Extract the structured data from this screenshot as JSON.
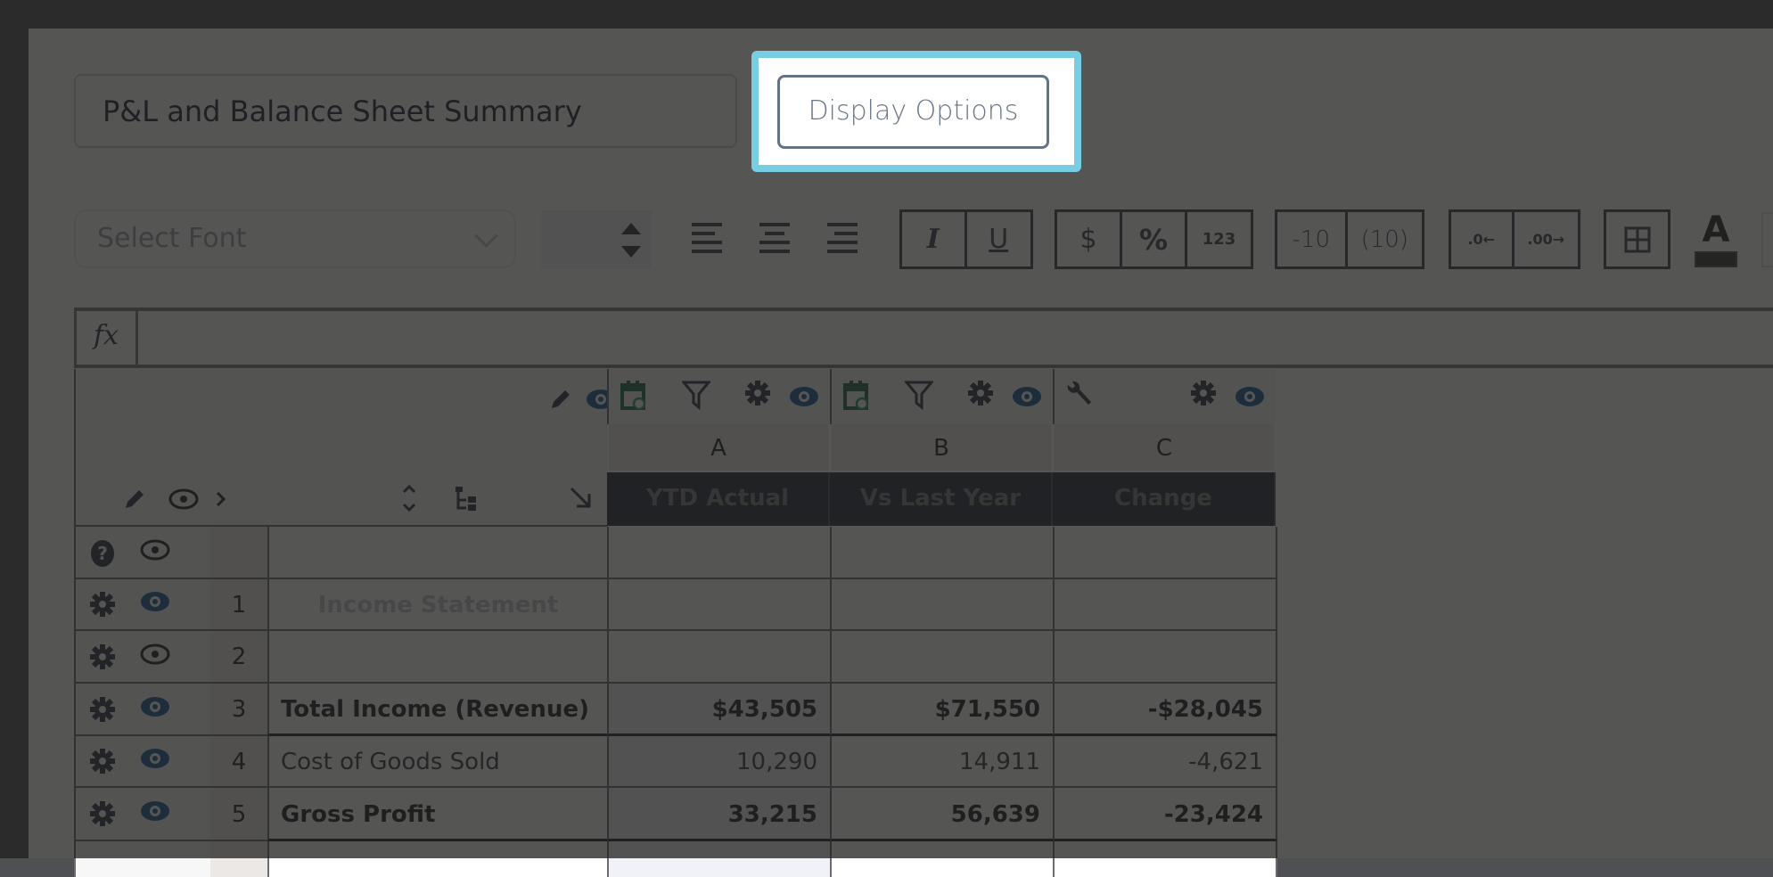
{
  "report": {
    "title": "P&L and Balance Sheet Summary",
    "display_options_label": "Display Options"
  },
  "toolbar": {
    "font_placeholder": "Select Font",
    "font_size_value": "",
    "align": [
      "align-left",
      "align-center",
      "align-right"
    ],
    "style_buttons": [
      "I",
      "U"
    ],
    "format_buttons": [
      "$",
      "%",
      "123"
    ],
    "negative_buttons": [
      "-10",
      "(10)"
    ],
    "decimal_buttons": [
      ".0←",
      ".00→"
    ],
    "border_button": "borders",
    "text_color_label": "A"
  },
  "formula_bar": {
    "icon": "fx",
    "value": ""
  },
  "grid": {
    "columns": [
      {
        "letter": "A",
        "title": "YTD Actual",
        "icons": [
          "calendar-refresh-icon",
          "filter-icon",
          "gear-icon",
          "eye-icon"
        ]
      },
      {
        "letter": "B",
        "title": "Vs Last Year",
        "icons": [
          "calendar-refresh-icon",
          "filter-icon",
          "gear-icon",
          "eye-icon"
        ]
      },
      {
        "letter": "C",
        "title": "Change",
        "icons": [
          "wrench-icon",
          "gear-icon",
          "eye-icon"
        ]
      }
    ],
    "rows": [
      {
        "num": "",
        "label": "",
        "values": [
          "",
          "",
          ""
        ],
        "style": "header-spacer",
        "visible": false
      },
      {
        "num": "1",
        "label": "Income Statement",
        "values": [
          "",
          "",
          ""
        ],
        "style": "section",
        "visible": true
      },
      {
        "num": "2",
        "label": "",
        "values": [
          "",
          "",
          ""
        ],
        "style": "blank",
        "visible": false
      },
      {
        "num": "3",
        "label": "Total Income (Revenue)",
        "values": [
          "$43,505",
          "$71,550",
          "-$28,045"
        ],
        "style": "bold",
        "visible": true
      },
      {
        "num": "4",
        "label": "Cost of Goods Sold",
        "values": [
          "10,290",
          "14,911",
          "-4,621"
        ],
        "style": "normal",
        "visible": true
      },
      {
        "num": "5",
        "label": "Gross Profit",
        "values": [
          "33,215",
          "56,639",
          "-23,424"
        ],
        "style": "bold",
        "visible": true
      }
    ]
  },
  "colors": {
    "highlight": "#78cde2",
    "header_dark": "#232c3a",
    "eye_active": "#1a5a9a",
    "calendar_green": "#1f6b4a"
  }
}
